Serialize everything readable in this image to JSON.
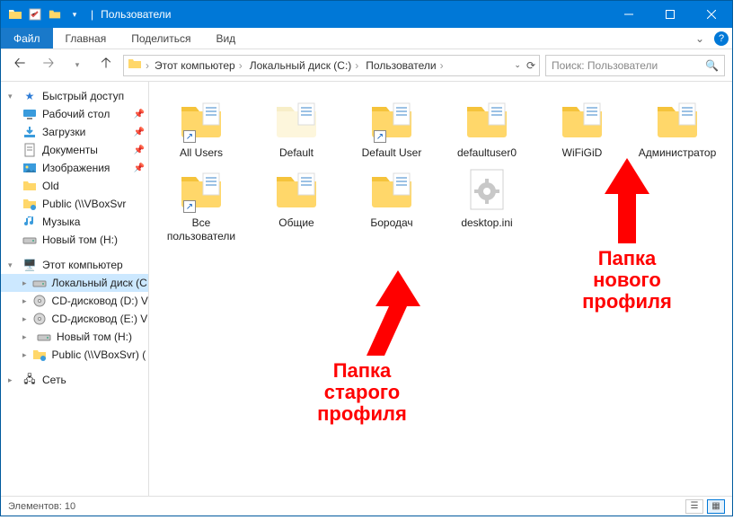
{
  "title": "Пользователи",
  "menu": {
    "file": "Файл",
    "main": "Главная",
    "share": "Поделиться",
    "view": "Вид"
  },
  "breadcrumbs": [
    "Этот компьютер",
    "Локальный диск (C:)",
    "Пользователи"
  ],
  "search_placeholder": "Поиск: Пользователи",
  "sidebar": {
    "quick": "Быстрый доступ",
    "items": [
      {
        "label": "Рабочий стол",
        "icon": "desktop",
        "pinned": true
      },
      {
        "label": "Загрузки",
        "icon": "downloads",
        "pinned": true
      },
      {
        "label": "Документы",
        "icon": "documents",
        "pinned": true
      },
      {
        "label": "Изображения",
        "icon": "pictures",
        "pinned": true
      },
      {
        "label": "Old",
        "icon": "folder",
        "pinned": false
      },
      {
        "label": "Public (\\\\VBoxSvr",
        "icon": "netfolder",
        "pinned": false
      },
      {
        "label": "Музыка",
        "icon": "music",
        "pinned": false
      },
      {
        "label": "Новый том (H:)",
        "icon": "drive",
        "pinned": false
      }
    ],
    "thispc": "Этот компьютер",
    "drives": [
      {
        "label": "Локальный диск (C",
        "icon": "drive",
        "selected": true
      },
      {
        "label": "CD-дисковод (D:) V",
        "icon": "cd"
      },
      {
        "label": "CD-дисковод (E:) V",
        "icon": "cd"
      },
      {
        "label": "Новый том (H:)",
        "icon": "drive"
      },
      {
        "label": "Public (\\\\VBoxSvr) (",
        "icon": "netfolder"
      }
    ],
    "network": "Сеть"
  },
  "files": [
    {
      "label": "All Users",
      "type": "folder",
      "shortcut": true
    },
    {
      "label": "Default",
      "type": "folder-light"
    },
    {
      "label": "Default User",
      "type": "folder",
      "shortcut": true
    },
    {
      "label": "defaultuser0",
      "type": "folder"
    },
    {
      "label": "WiFiGiD",
      "type": "folder"
    },
    {
      "label": "Администратор",
      "type": "folder"
    },
    {
      "label": "Все пользователи",
      "type": "folder",
      "shortcut": true
    },
    {
      "label": "Общие",
      "type": "folder"
    },
    {
      "label": "Бородач",
      "type": "folder"
    },
    {
      "label": "desktop.ini",
      "type": "ini"
    }
  ],
  "status": {
    "count_label": "Элементов: 10"
  },
  "annotations": {
    "old_profile": "Папка\nстарого\nпрофиля",
    "new_profile": "Папка\nнового\nпрофиля"
  }
}
